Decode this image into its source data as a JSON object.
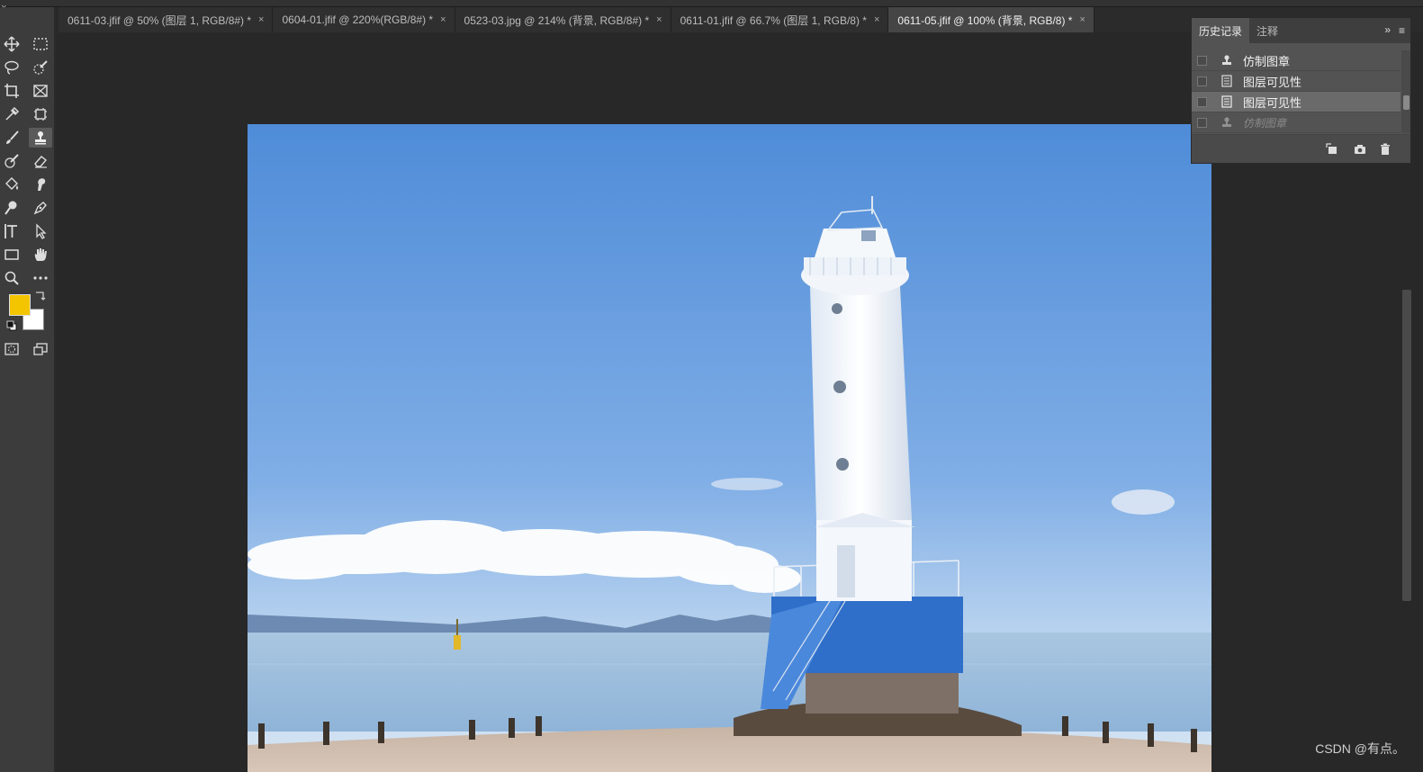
{
  "window": {
    "close_glyph": "×"
  },
  "tabs": [
    {
      "label": "0611-03.jfif @ 50% (图层 1, RGB/8#) *",
      "close": "×",
      "active": false
    },
    {
      "label": "0604-01.jfif @ 220%(RGB/8#) *",
      "close": "×",
      "active": false
    },
    {
      "label": "0523-03.jpg @ 214% (背景, RGB/8#) *",
      "close": "×",
      "active": false
    },
    {
      "label": "0611-01.jfif @ 66.7% (图层 1, RGB/8) *",
      "close": "×",
      "active": false
    },
    {
      "label": "0611-05.jfif @ 100% (背景, RGB/8) *",
      "close": "×",
      "active": true
    }
  ],
  "toolbar": {
    "tools": [
      "move-tool",
      "rectangular-marquee-tool",
      "lasso-tool",
      "quick-selection-tool",
      "crop-tool",
      "frame-tool",
      "eyedropper-tool",
      "object-selection-tool",
      "brush-tool",
      "clone-stamp-tool",
      "history-brush-tool",
      "eraser-tool",
      "paint-bucket-tool",
      "smudge-tool",
      "dodge-tool",
      "pen-tool",
      "type-tool",
      "path-selection-tool",
      "rectangle-tool",
      "hand-tool",
      "zoom-tool",
      "more-tools"
    ],
    "active_tool": "clone-stamp-tool",
    "foreground_color": "#f2c500",
    "background_color": "#ffffff"
  },
  "history_panel": {
    "tabs": [
      "历史记录",
      "注释"
    ],
    "active_tab": "历史记录",
    "items": [
      {
        "label": "仿制图章",
        "icon": "stamp-icon",
        "state": "normal"
      },
      {
        "label": "图层可见性",
        "icon": "layer-doc-icon",
        "state": "normal"
      },
      {
        "label": "图层可见性",
        "icon": "layer-doc-icon",
        "state": "active"
      },
      {
        "label": "仿制图章",
        "icon": "stamp-icon",
        "state": "dim"
      }
    ],
    "footer_buttons": [
      "new-document-from-state-button",
      "snapshot-button",
      "delete-button"
    ]
  },
  "watermark": "CSDN @有点。"
}
